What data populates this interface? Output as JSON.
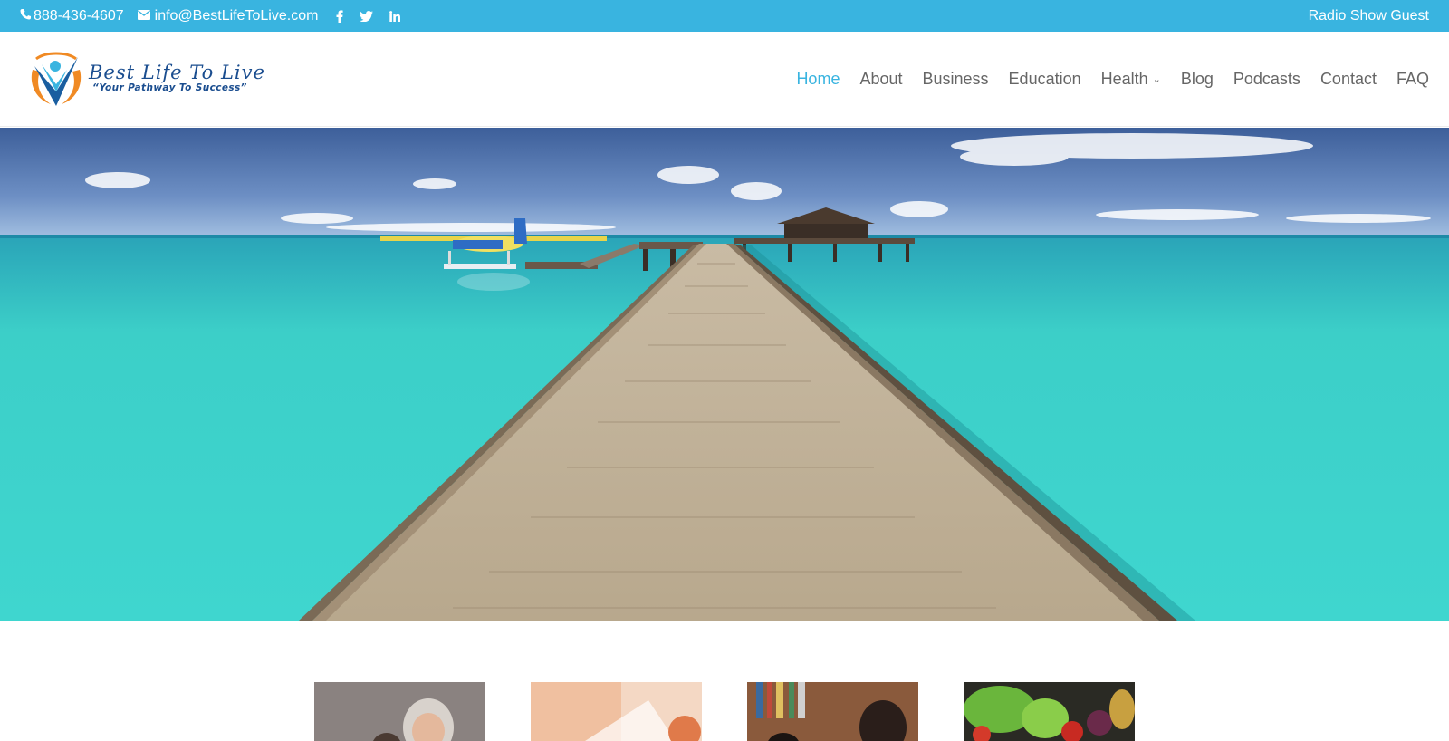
{
  "topbar": {
    "phone": "888-436-4607",
    "email": "info@BestLifeToLive.com",
    "social_icons": [
      "facebook-icon",
      "twitter-icon",
      "linkedin-icon"
    ],
    "radio_link": "Radio Show Guest"
  },
  "logo": {
    "name": "Best Life To Live",
    "tagline": "“Your Pathway To Success”"
  },
  "nav": {
    "items": [
      {
        "label": "Home",
        "active": true
      },
      {
        "label": "About"
      },
      {
        "label": "Business"
      },
      {
        "label": "Education"
      },
      {
        "label": "Health",
        "has_dropdown": true
      },
      {
        "label": "Blog"
      },
      {
        "label": "Podcasts"
      },
      {
        "label": "Contact"
      },
      {
        "label": "FAQ"
      }
    ]
  },
  "colors": {
    "accent": "#39b4e0",
    "nav_text": "#666666",
    "logo_blue": "#1a4d8f",
    "logo_orange": "#f08a24"
  },
  "hero": {
    "description_icon": "hero-pier-image"
  },
  "thumbnails": [
    "senior-woman-thumbnail",
    "medical-thumbnail",
    "students-thumbnail",
    "vegetables-thumbnail"
  ]
}
